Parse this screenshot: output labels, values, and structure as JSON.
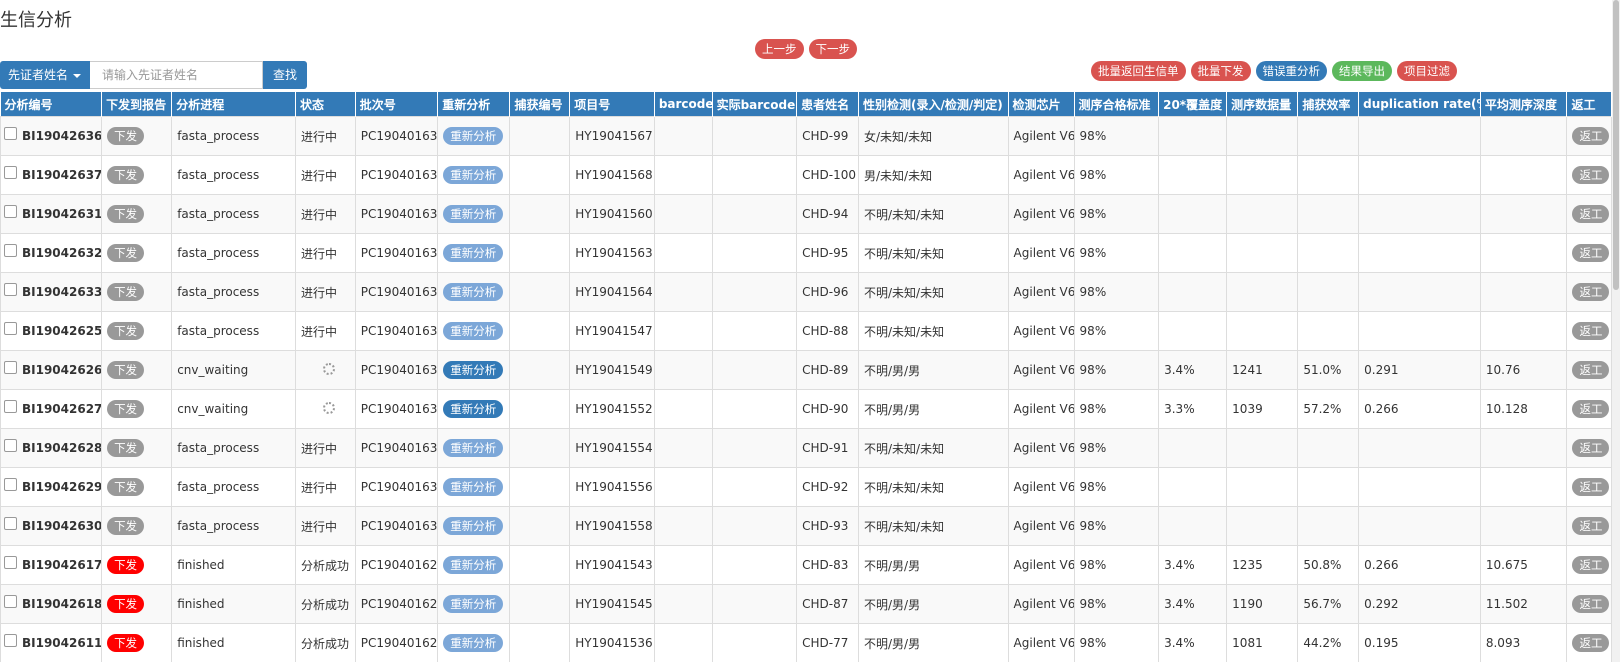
{
  "page_title": "生信分析",
  "pager": {
    "prev": "上一步",
    "next": "下一步"
  },
  "actions": [
    {
      "label": "批量返回生信单",
      "color": "#d9534f"
    },
    {
      "label": "批量下发",
      "color": "#d9534f"
    },
    {
      "label": "错误重分析",
      "color": "#337ab7"
    },
    {
      "label": "结果导出",
      "color": "#5cb85c"
    },
    {
      "label": "项目过滤",
      "color": "#d9534f"
    }
  ],
  "search": {
    "field_label": "先证者姓名",
    "placeholder": "请输入先证者姓名",
    "button": "查找"
  },
  "table": {
    "headers": [
      "分析编号",
      "下发到报告",
      "分析进程",
      "状态",
      "批次号",
      "重新分析",
      "捕获编号",
      "项目号",
      "barcode",
      "实际barcode",
      "患者姓名",
      "性别检测(录入/检测/判定)",
      "检测芯片",
      "测序合格标准",
      "20*覆盖度",
      "测序数据量",
      "捕获效率",
      "duplication rate(%)",
      "平均测序深度",
      "返工"
    ],
    "dispatch_label": "下发",
    "reanalyze_label": "重新分析",
    "rework_label": "返工",
    "rows": [
      {
        "id": "BI19042636",
        "dispatch_state": "gray",
        "process": "fasta_process",
        "status": "进行中",
        "status_spinner": false,
        "batch": "PC19040163",
        "reanalyze_state": "light",
        "capture": "",
        "project": "HY19041567",
        "barcode": "",
        "actual_barcode": "",
        "patient": "CHD-99",
        "sex": "女/未知/未知",
        "chip": "Agilent V6",
        "standard": "98%",
        "coverage": "",
        "data_amount": "",
        "capture_eff": "",
        "dup_rate": "",
        "depth": ""
      },
      {
        "id": "BI19042637",
        "dispatch_state": "gray",
        "process": "fasta_process",
        "status": "进行中",
        "status_spinner": false,
        "batch": "PC19040163",
        "reanalyze_state": "light",
        "capture": "",
        "project": "HY19041568",
        "barcode": "",
        "actual_barcode": "",
        "patient": "CHD-100",
        "sex": "男/未知/未知",
        "chip": "Agilent V6",
        "standard": "98%",
        "coverage": "",
        "data_amount": "",
        "capture_eff": "",
        "dup_rate": "",
        "depth": ""
      },
      {
        "id": "BI19042631",
        "dispatch_state": "gray",
        "process": "fasta_process",
        "status": "进行中",
        "status_spinner": false,
        "batch": "PC19040163",
        "reanalyze_state": "light",
        "capture": "",
        "project": "HY19041560",
        "barcode": "",
        "actual_barcode": "",
        "patient": "CHD-94",
        "sex": "不明/未知/未知",
        "chip": "Agilent V6",
        "standard": "98%",
        "coverage": "",
        "data_amount": "",
        "capture_eff": "",
        "dup_rate": "",
        "depth": ""
      },
      {
        "id": "BI19042632",
        "dispatch_state": "gray",
        "process": "fasta_process",
        "status": "进行中",
        "status_spinner": false,
        "batch": "PC19040163",
        "reanalyze_state": "light",
        "capture": "",
        "project": "HY19041563",
        "barcode": "",
        "actual_barcode": "",
        "patient": "CHD-95",
        "sex": "不明/未知/未知",
        "chip": "Agilent V6",
        "standard": "98%",
        "coverage": "",
        "data_amount": "",
        "capture_eff": "",
        "dup_rate": "",
        "depth": ""
      },
      {
        "id": "BI19042633",
        "dispatch_state": "gray",
        "process": "fasta_process",
        "status": "进行中",
        "status_spinner": false,
        "batch": "PC19040163",
        "reanalyze_state": "light",
        "capture": "",
        "project": "HY19041564",
        "barcode": "",
        "actual_barcode": "",
        "patient": "CHD-96",
        "sex": "不明/未知/未知",
        "chip": "Agilent V6",
        "standard": "98%",
        "coverage": "",
        "data_amount": "",
        "capture_eff": "",
        "dup_rate": "",
        "depth": ""
      },
      {
        "id": "BI19042625",
        "dispatch_state": "gray",
        "process": "fasta_process",
        "status": "进行中",
        "status_spinner": false,
        "batch": "PC19040163",
        "reanalyze_state": "light",
        "capture": "",
        "project": "HY19041547",
        "barcode": "",
        "actual_barcode": "",
        "patient": "CHD-88",
        "sex": "不明/未知/未知",
        "chip": "Agilent V6",
        "standard": "98%",
        "coverage": "",
        "data_amount": "",
        "capture_eff": "",
        "dup_rate": "",
        "depth": ""
      },
      {
        "id": "BI19042626",
        "dispatch_state": "gray",
        "process": "cnv_waiting",
        "status": "",
        "status_spinner": true,
        "batch": "PC19040163",
        "reanalyze_state": "dark",
        "capture": "",
        "project": "HY19041549",
        "barcode": "",
        "actual_barcode": "",
        "patient": "CHD-89",
        "sex": "不明/男/男",
        "chip": "Agilent V6",
        "standard": "98%",
        "coverage": "3.4%",
        "data_amount": "1241",
        "capture_eff": "51.0%",
        "dup_rate": "0.291",
        "depth": "10.76"
      },
      {
        "id": "BI19042627",
        "dispatch_state": "gray",
        "process": "cnv_waiting",
        "status": "",
        "status_spinner": true,
        "batch": "PC19040163",
        "reanalyze_state": "dark",
        "capture": "",
        "project": "HY19041552",
        "barcode": "",
        "actual_barcode": "",
        "patient": "CHD-90",
        "sex": "不明/男/男",
        "chip": "Agilent V6",
        "standard": "98%",
        "coverage": "3.3%",
        "data_amount": "1039",
        "capture_eff": "57.2%",
        "dup_rate": "0.266",
        "depth": "10.128"
      },
      {
        "id": "BI19042628",
        "dispatch_state": "gray",
        "process": "fasta_process",
        "status": "进行中",
        "status_spinner": false,
        "batch": "PC19040163",
        "reanalyze_state": "light",
        "capture": "",
        "project": "HY19041554",
        "barcode": "",
        "actual_barcode": "",
        "patient": "CHD-91",
        "sex": "不明/未知/未知",
        "chip": "Agilent V6",
        "standard": "98%",
        "coverage": "",
        "data_amount": "",
        "capture_eff": "",
        "dup_rate": "",
        "depth": ""
      },
      {
        "id": "BI19042629",
        "dispatch_state": "gray",
        "process": "fasta_process",
        "status": "进行中",
        "status_spinner": false,
        "batch": "PC19040163",
        "reanalyze_state": "light",
        "capture": "",
        "project": "HY19041556",
        "barcode": "",
        "actual_barcode": "",
        "patient": "CHD-92",
        "sex": "不明/未知/未知",
        "chip": "Agilent V6",
        "standard": "98%",
        "coverage": "",
        "data_amount": "",
        "capture_eff": "",
        "dup_rate": "",
        "depth": ""
      },
      {
        "id": "BI19042630",
        "dispatch_state": "gray",
        "process": "fasta_process",
        "status": "进行中",
        "status_spinner": false,
        "batch": "PC19040163",
        "reanalyze_state": "light",
        "capture": "",
        "project": "HY19041558",
        "barcode": "",
        "actual_barcode": "",
        "patient": "CHD-93",
        "sex": "不明/未知/未知",
        "chip": "Agilent V6",
        "standard": "98%",
        "coverage": "",
        "data_amount": "",
        "capture_eff": "",
        "dup_rate": "",
        "depth": ""
      },
      {
        "id": "BI19042617",
        "dispatch_state": "red",
        "process": "finished",
        "status": "分析成功",
        "status_spinner": false,
        "batch": "PC19040162",
        "reanalyze_state": "light",
        "capture": "",
        "project": "HY19041543",
        "barcode": "",
        "actual_barcode": "",
        "patient": "CHD-83",
        "sex": "不明/男/男",
        "chip": "Agilent V6",
        "standard": "98%",
        "coverage": "3.4%",
        "data_amount": "1235",
        "capture_eff": "50.8%",
        "dup_rate": "0.266",
        "depth": "10.675"
      },
      {
        "id": "BI19042618",
        "dispatch_state": "red",
        "process": "finished",
        "status": "分析成功",
        "status_spinner": false,
        "batch": "PC19040162",
        "reanalyze_state": "light",
        "capture": "",
        "project": "HY19041545",
        "barcode": "",
        "actual_barcode": "",
        "patient": "CHD-87",
        "sex": "不明/男/男",
        "chip": "Agilent V6",
        "standard": "98%",
        "coverage": "3.4%",
        "data_amount": "1190",
        "capture_eff": "56.7%",
        "dup_rate": "0.292",
        "depth": "11.502"
      },
      {
        "id": "BI19042611",
        "dispatch_state": "red",
        "process": "finished",
        "status": "分析成功",
        "status_spinner": false,
        "batch": "PC19040162",
        "reanalyze_state": "light",
        "capture": "",
        "project": "HY19041536",
        "barcode": "",
        "actual_barcode": "",
        "patient": "CHD-77",
        "sex": "不明/男/男",
        "chip": "Agilent V6",
        "standard": "98%",
        "coverage": "3.4%",
        "data_amount": "1081",
        "capture_eff": "44.2%",
        "dup_rate": "0.195",
        "depth": "8.093"
      }
    ]
  }
}
